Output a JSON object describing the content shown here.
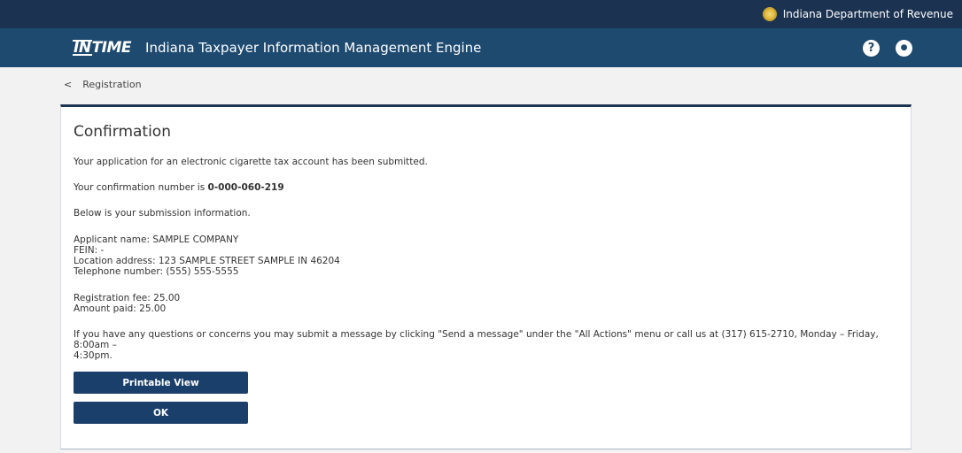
{
  "topbar": {
    "department": "Indiana Department of Revenue",
    "seal_icon": "state-seal-icon"
  },
  "header": {
    "logo_prefix": "IN",
    "logo_suffix": "TIME",
    "title": "Indiana Taxpayer Information Management Engine",
    "help_icon": "question-circle-icon",
    "help_glyph": "?",
    "user_icon": "user-circle-icon",
    "user_glyph": "●"
  },
  "breadcrumb": {
    "chevron": "<",
    "label": "Registration"
  },
  "confirmation": {
    "heading": "Confirmation",
    "submitted_text": "Your application for an electronic cigarette tax account has been submitted.",
    "confirmation_prefix": "Your confirmation number is ",
    "confirmation_number": "0-000-060-219",
    "below_text": "Below is your submission information.",
    "applicant_name": "Applicant name: SAMPLE COMPANY",
    "fein": "FEIN: -",
    "location_address": "Location address: 123 SAMPLE STREET SAMPLE IN 46204",
    "telephone": "Telephone number: (555) 555-5555",
    "registration_fee": "Registration fee: 25.00",
    "amount_paid": "Amount paid: 25.00",
    "contact_line1": "If you have any questions or concerns you may submit a message by clicking \"Send a message\" under the \"All Actions\" menu or call us at (317) 615-2710, Monday – Friday, 8:00am –",
    "contact_line2": "4:30pm."
  },
  "buttons": {
    "printable_view": "Printable View",
    "ok": "OK"
  }
}
